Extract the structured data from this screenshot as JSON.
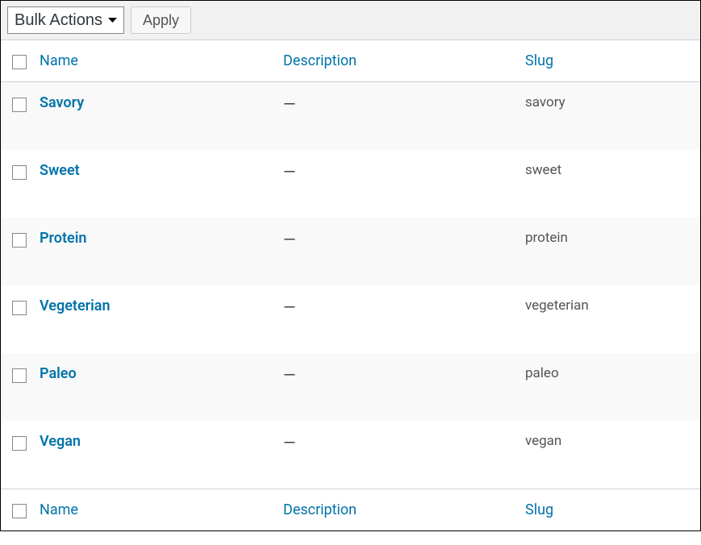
{
  "toolbar": {
    "bulk_label": "Bulk Actions",
    "apply_label": "Apply"
  },
  "columns": {
    "name": "Name",
    "description": "Description",
    "slug": "Slug"
  },
  "rows": [
    {
      "name": "Savory",
      "description": "—",
      "slug": "savory"
    },
    {
      "name": "Sweet",
      "description": "—",
      "slug": "sweet"
    },
    {
      "name": "Protein",
      "description": "—",
      "slug": "protein"
    },
    {
      "name": "Vegeterian",
      "description": "—",
      "slug": "vegeterian"
    },
    {
      "name": "Paleo",
      "description": "—",
      "slug": "paleo"
    },
    {
      "name": "Vegan",
      "description": "—",
      "slug": "vegan"
    }
  ]
}
